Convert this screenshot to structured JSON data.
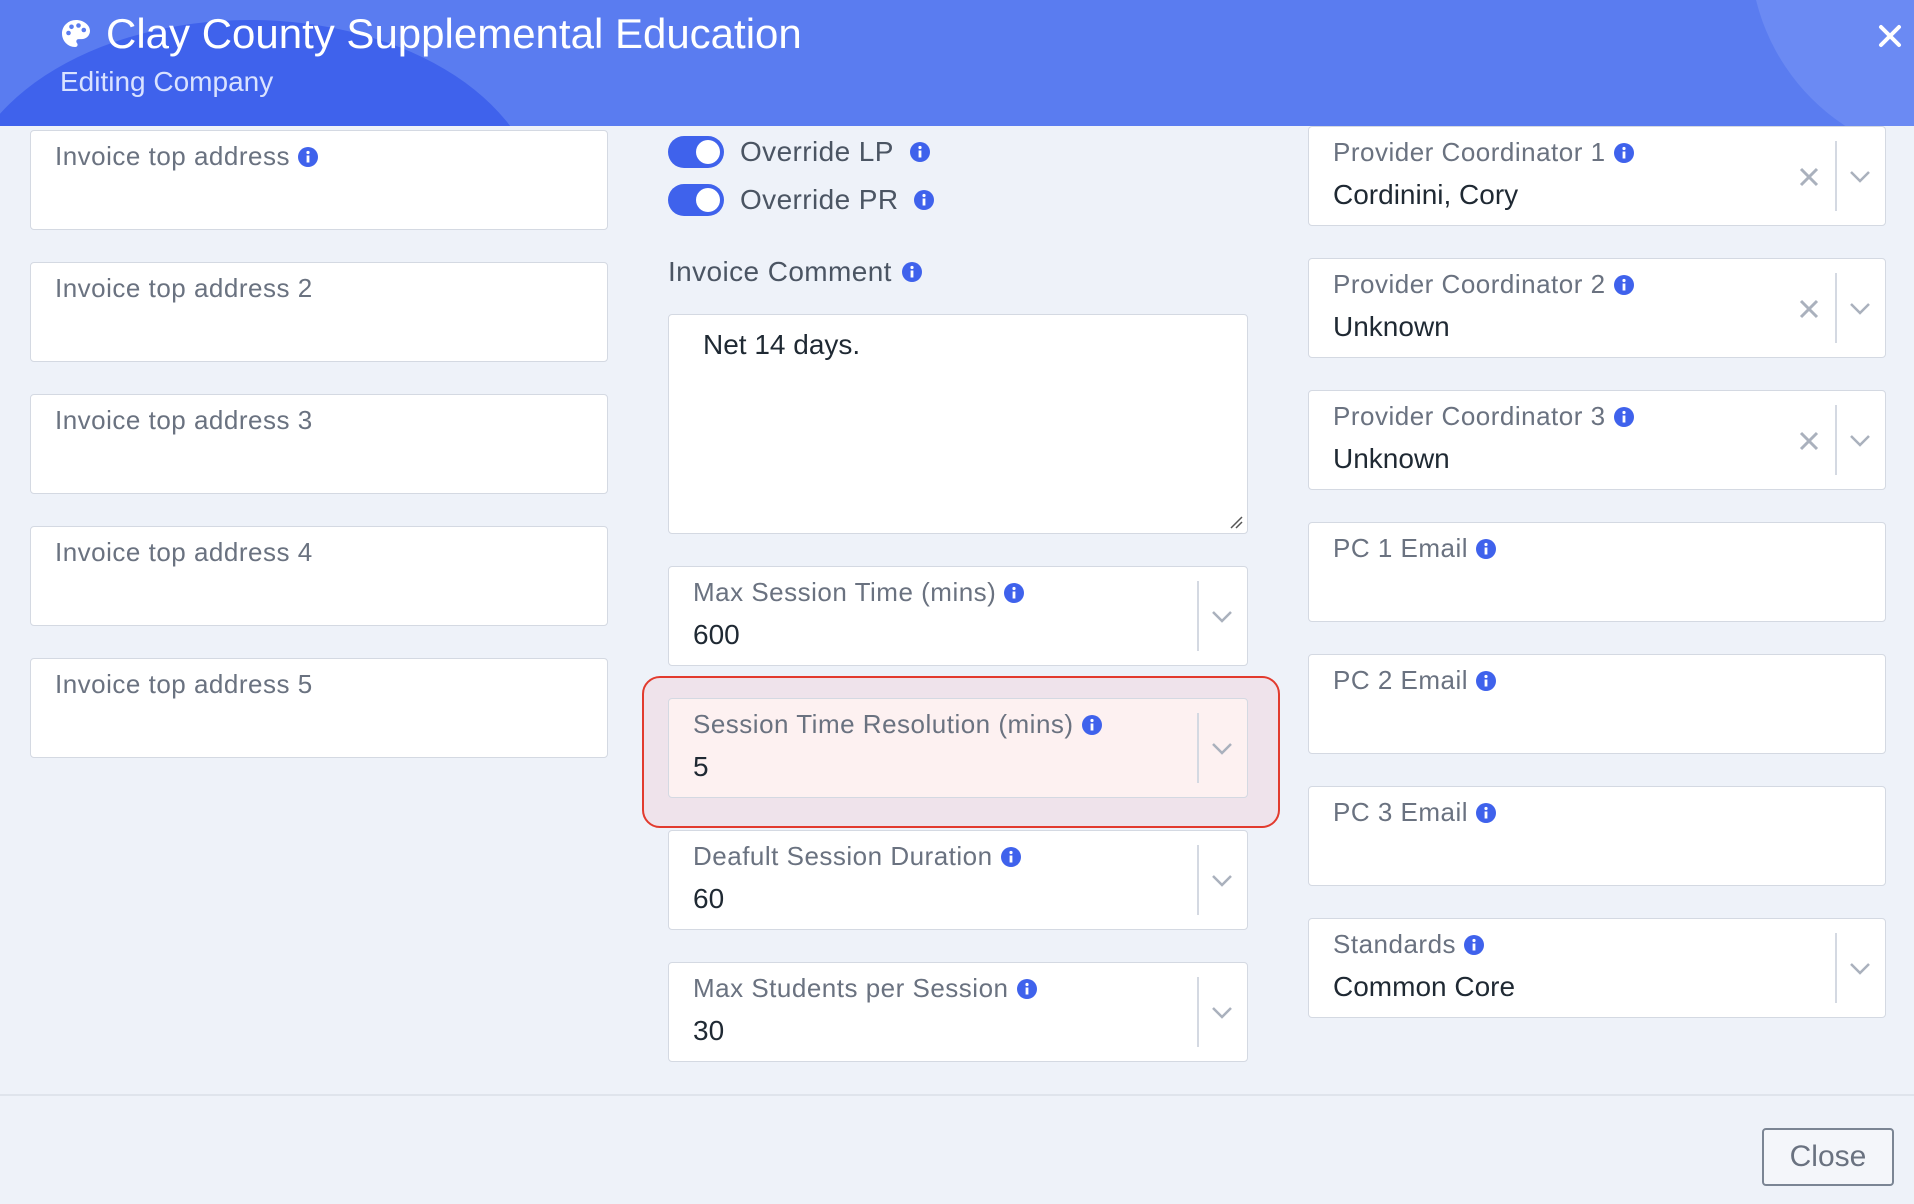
{
  "header": {
    "title": "Clay County Supplemental Education",
    "subtitle": "Editing Company",
    "icon": "palette-icon",
    "close_icon": "close-icon"
  },
  "left_column": {
    "fields": [
      {
        "label": "Invoice top address",
        "value": "",
        "info": true
      },
      {
        "label": "Invoice top address 2",
        "value": "",
        "info": false
      },
      {
        "label": "Invoice top address 3",
        "value": "",
        "info": false
      },
      {
        "label": "Invoice top address 4",
        "value": "",
        "info": false
      },
      {
        "label": "Invoice top address 5",
        "value": "",
        "info": false
      }
    ]
  },
  "middle_column": {
    "toggles": [
      {
        "label": "Override LP",
        "on": true
      },
      {
        "label": "Override PR",
        "on": true
      }
    ],
    "invoice_comment": {
      "label": "Invoice Comment",
      "value": "Net 14 days."
    },
    "selects": [
      {
        "label": "Max Session Time (mins)",
        "value": "600"
      },
      {
        "label": "Session Time Resolution (mins)",
        "value": "5",
        "highlighted": true
      },
      {
        "label": "Deafult Session Duration",
        "value": "60"
      },
      {
        "label": "Max Students per Session",
        "value": "30"
      }
    ]
  },
  "right_column": {
    "selects": [
      {
        "label": "Provider Coordinator 1",
        "value": "Cordinini, Cory",
        "clearable": true
      },
      {
        "label": "Provider Coordinator 2",
        "value": "Unknown",
        "clearable": true
      },
      {
        "label": "Provider Coordinator 3",
        "value": "Unknown",
        "clearable": true
      }
    ],
    "emails": [
      {
        "label": "PC 1 Email",
        "value": ""
      },
      {
        "label": "PC 2 Email",
        "value": ""
      },
      {
        "label": "PC 3 Email",
        "value": ""
      }
    ],
    "standards": {
      "label": "Standards",
      "value": "Common Core"
    }
  },
  "footer": {
    "close_label": "Close"
  },
  "colors": {
    "header_bg": "#5a7cf0",
    "accent": "#3f62ec",
    "highlight_border": "#e23b2e"
  }
}
